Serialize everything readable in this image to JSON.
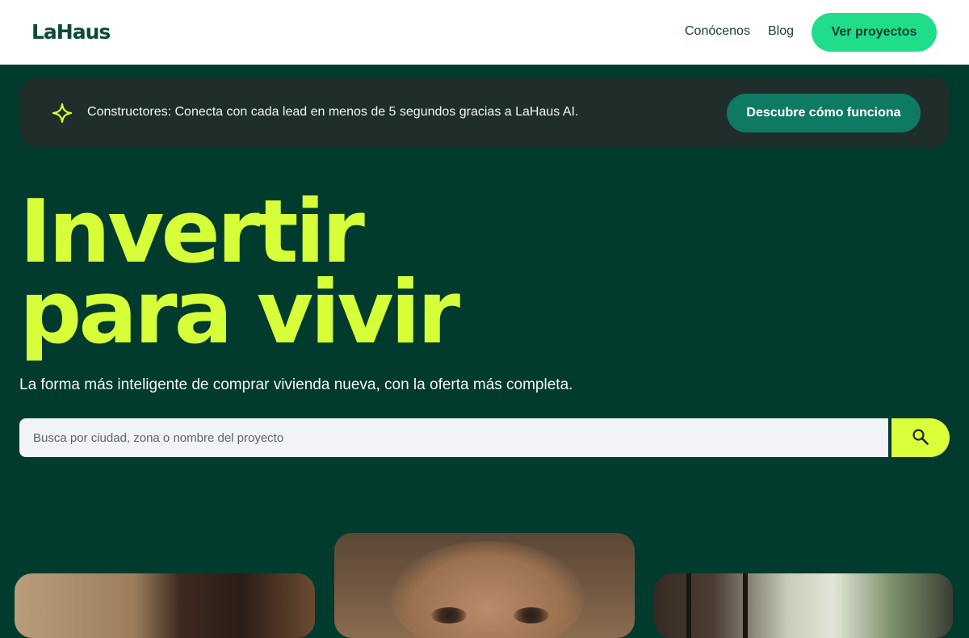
{
  "header": {
    "logo": "LaHaus",
    "nav": [
      {
        "label": "Conócenos"
      },
      {
        "label": "Blog"
      }
    ],
    "cta_label": "Ver proyectos"
  },
  "banner": {
    "icon": "sparkle-icon",
    "text": "Constructores: Conecta con cada lead en menos de 5 segundos gracias a LaHaus AI.",
    "button_label": "Descubre cómo funciona"
  },
  "hero": {
    "title_line1": "Invertir",
    "title_line2": "para vivir",
    "subtitle": "La forma más inteligente de comprar vivienda nueva, con la oferta más completa."
  },
  "search": {
    "placeholder": "Busca por ciudad, zona o nombre del proyecto",
    "button_icon": "search-icon"
  },
  "colors": {
    "background": "#003b2e",
    "accent_lime": "#d6ff3a",
    "cta_green": "#20dd8a",
    "banner_button": "#0f7a63"
  }
}
